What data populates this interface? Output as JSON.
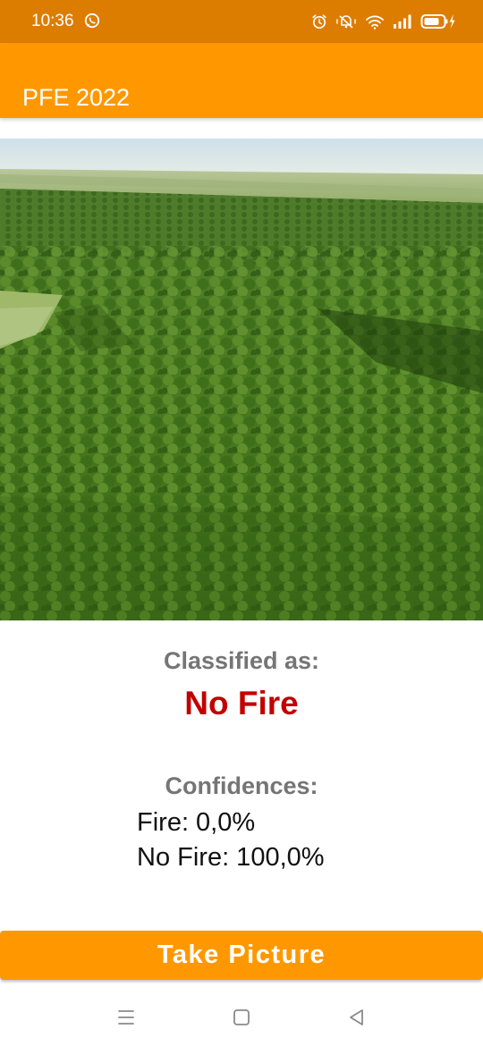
{
  "status_bar": {
    "time": "10:36",
    "left_icons": [
      "whatsapp-icon"
    ],
    "right_icons": [
      "alarm-icon",
      "vibrate-icon",
      "wifi-icon",
      "signal-icon",
      "battery-charging-icon"
    ],
    "background_color": "#dd7d00"
  },
  "app_bar": {
    "title": "PFE 2022",
    "background_color": "#ff9800"
  },
  "image": {
    "subject": "forest-photo"
  },
  "classification": {
    "label": "Classified as:",
    "result": "No Fire",
    "result_color": "#c20000"
  },
  "confidences": {
    "label": "Confidences:",
    "fire": "Fire: 0,0%",
    "no_fire": "No Fire: 100,0%"
  },
  "action_button": {
    "label": "Take Picture",
    "color": "#ff9800"
  },
  "nav_bar": {
    "buttons": [
      "menu-icon",
      "home-icon",
      "back-icon"
    ]
  }
}
